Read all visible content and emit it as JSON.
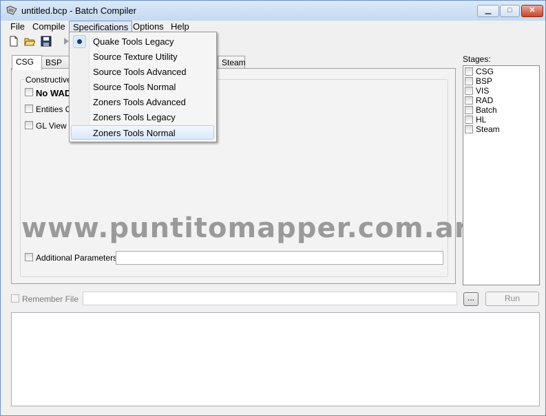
{
  "window": {
    "title": "untitled.bcp - Batch Compiler",
    "minimize_glyph": "▁",
    "maximize_glyph": "□",
    "close_glyph": "✕"
  },
  "menubar": {
    "items": [
      "File",
      "Compile",
      "Specifications",
      "Options",
      "Help"
    ]
  },
  "toolbar": {
    "icons": [
      "new-file-icon",
      "open-folder-icon",
      "save-icon",
      "run-arrow-icon"
    ]
  },
  "tabs": {
    "visible": [
      "CSG",
      "BSP",
      "Steam"
    ],
    "selected": "CSG"
  },
  "csg_panel": {
    "group_label": "Constructive",
    "options": [
      {
        "label": "No WAD",
        "checked": false
      },
      {
        "label": "Entities Or",
        "checked": false
      },
      {
        "label": "GL View",
        "checked": false
      }
    ],
    "additional_parameters_label": "Additional Parameters",
    "additional_parameters_value": ""
  },
  "watermark": "www.puntitomapper.com.ar",
  "stages": {
    "label": "Stages:",
    "items": [
      {
        "label": "CSG",
        "checked": false
      },
      {
        "label": "BSP",
        "checked": false
      },
      {
        "label": "VIS",
        "checked": false
      },
      {
        "label": "RAD",
        "checked": false
      },
      {
        "label": "Batch",
        "checked": false
      },
      {
        "label": "HL",
        "checked": false
      },
      {
        "label": "Steam",
        "checked": false
      }
    ]
  },
  "bottom": {
    "remember_file_label": "Remember File",
    "remember_file_value": "",
    "browse_label": "...",
    "run_label": "Run"
  },
  "specifications_menu": {
    "items": [
      {
        "label": "Quake Tools Legacy",
        "selected": true
      },
      {
        "label": "Source Texture Utility",
        "selected": false
      },
      {
        "label": "Source Tools Advanced",
        "selected": false
      },
      {
        "label": "Source Tools Normal",
        "selected": false
      },
      {
        "label": "Zoners Tools Advanced",
        "selected": false
      },
      {
        "label": "Zoners Tools Legacy",
        "selected": false
      },
      {
        "label": "Zoners Tools Normal",
        "selected": false
      }
    ],
    "hovered": "Zoners Tools Normal"
  }
}
